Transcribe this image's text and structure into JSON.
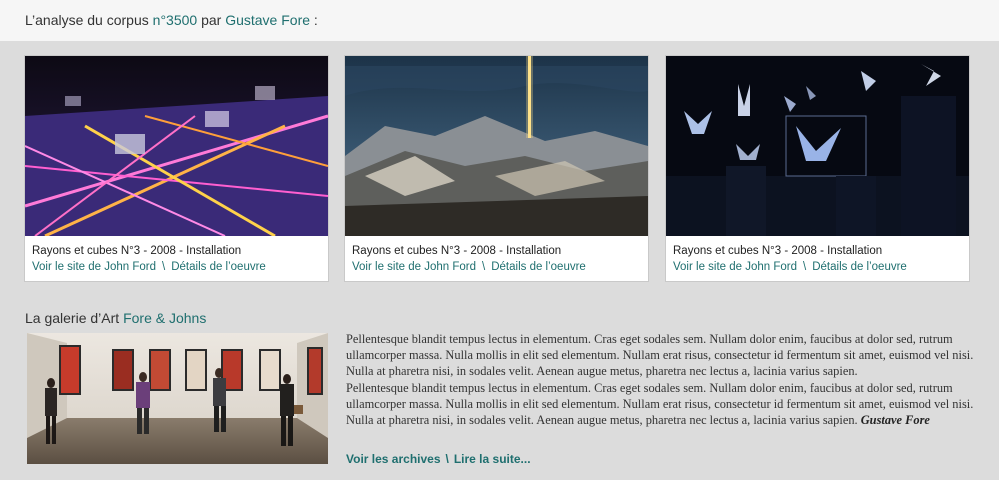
{
  "header": {
    "prefix": "L’analyse du corpus",
    "corpus_number": "n°3500",
    "by": "par",
    "author": "Gustave Fore",
    "suffix": ":"
  },
  "cards": [
    {
      "caption": "Rayons et cubes N°3 - 2008 - Installation",
      "site_link": "Voir le site de John Ford",
      "separator": "\\",
      "details_link": "Détails de l’oeuvre"
    },
    {
      "caption": "Rayons et cubes N°3 - 2008 - Installation",
      "site_link": "Voir le site de John Ford",
      "separator": "\\",
      "details_link": "Détails de l’oeuvre"
    },
    {
      "caption": "Rayons et cubes N°3 - 2008 - Installation",
      "site_link": "Voir le site de John Ford",
      "separator": "\\",
      "details_link": "Détails de l’oeuvre"
    }
  ],
  "gallery": {
    "title_prefix": "La galerie d’Art",
    "title_name": "Fore & Johns",
    "paragraph1": "Pellentesque blandit tempus lectus in elementum. Cras eget sodales sem. Nullam dolor enim, faucibus at dolor sed, rutrum ullamcorper massa. Nulla mollis in elit sed elementum. Nullam erat risus, consectetur id fermentum sit amet, euismod vel nisi. Nulla at pharetra nisi, in sodales velit. Aenean augue metus, pharetra nec lectus a, lacinia varius sapien.",
    "paragraph2": "Pellentesque blandit tempus lectus in elementum. Cras eget sodales sem. Nullam dolor enim, faucibus at dolor sed, rutrum ullamcorper massa. Nulla mollis in elit sed elementum. Nullam erat risus, consectetur id fermentum sit amet, euismod vel nisi. Nulla at pharetra nisi, in sodales velit. Aenean augue metus, pharetra nec lectus a, lacinia varius sapien.",
    "signature": "Gustave Fore",
    "archives_link": "Voir les archives",
    "separator": "\\",
    "more_link": "Lire la suite..."
  },
  "colors": {
    "accent": "#1f6f6f",
    "background": "#dcdcdc",
    "header_background": "#f6f6f6"
  }
}
